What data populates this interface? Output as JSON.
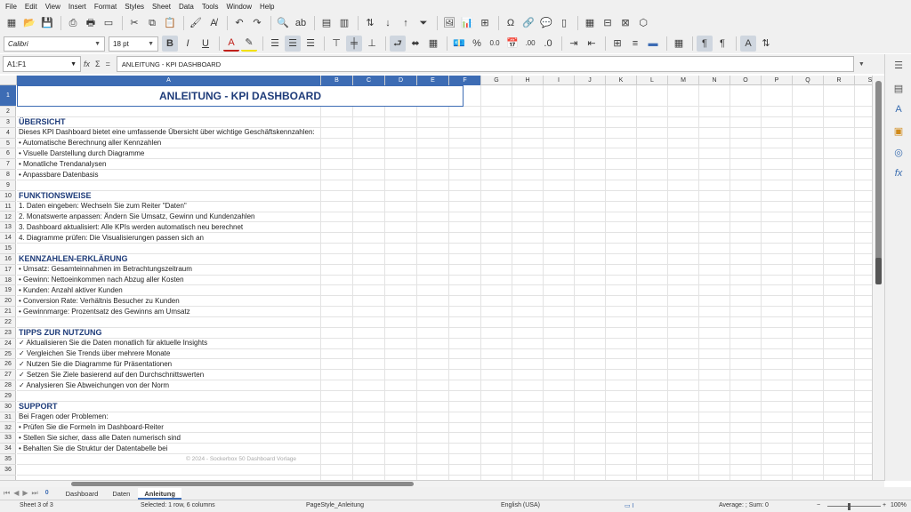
{
  "menu": [
    "File",
    "Edit",
    "View",
    "Insert",
    "Format",
    "Styles",
    "Sheet",
    "Data",
    "Tools",
    "Window",
    "Help"
  ],
  "toolbar": {
    "font_name": "Calibri",
    "font_size": "18 pt",
    "bold": "B",
    "italic": "I",
    "underline": "U",
    "percent": "%",
    "decimals": "0.0",
    "zero_decimal": ".00"
  },
  "formula_bar": {
    "name_box": "A1:F1",
    "fx": "fx",
    "sigma": "Σ",
    "equals": "=",
    "content": "ANLEITUNG - KPI DASHBOARD"
  },
  "grid": {
    "columns": [
      "A",
      "B",
      "C",
      "D",
      "E",
      "F",
      "G",
      "H",
      "I",
      "J",
      "K",
      "L",
      "M",
      "N",
      "O",
      "P",
      "Q",
      "R",
      "S"
    ],
    "rows": [
      "1",
      "2",
      "3",
      "4",
      "5",
      "6",
      "7",
      "8",
      "9",
      "10",
      "11",
      "12",
      "13",
      "14",
      "15",
      "16",
      "17",
      "18",
      "19",
      "20",
      "21",
      "22",
      "23",
      "24",
      "25",
      "26",
      "27",
      "28",
      "29",
      "30",
      "31",
      "32",
      "33",
      "34",
      "35",
      "36"
    ],
    "title": "ANLEITUNG - KPI DASHBOARD",
    "cells": {
      "r3": "ÜBERSICHT",
      "r4": "Dieses KPI Dashboard bietet eine umfassende Übersicht über wichtige Geschäftskennzahlen:",
      "r5": "• Automatische Berechnung aller Kennzahlen",
      "r6": "• Visuelle Darstellung durch Diagramme",
      "r7": "• Monatliche Trendanalysen",
      "r8": "• Anpassbare Datenbasis",
      "r10": "FUNKTIONSWEISE",
      "r11": "1. Daten eingeben: Wechseln Sie zum Reiter \"Daten\"",
      "r12": "2. Monatswerte anpassen: Ändern Sie Umsatz, Gewinn und Kundenzahlen",
      "r13": "3. Dashboard aktualisiert: Alle KPIs werden automatisch neu berechnet",
      "r14": "4. Diagramme prüfen: Die Visualisierungen passen sich an",
      "r16": "KENNZAHLEN-ERKLÄRUNG",
      "r17": "• Umsatz: Gesamteinnahmen im Betrachtungszeitraum",
      "r18": "• Gewinn: Nettoeinkommen nach Abzug aller Kosten",
      "r19": "• Kunden: Anzahl aktiver Kunden",
      "r20": "• Conversion Rate: Verhältnis Besucher zu Kunden",
      "r21": "• Gewinnmarge: Prozentsatz des Gewinns am Umsatz",
      "r23": "TIPPS ZUR NUTZUNG",
      "r24": "✓ Aktualisieren Sie die Daten monatlich für aktuelle Insights",
      "r25": "✓ Vergleichen Sie Trends über mehrere Monate",
      "r26": "✓ Nutzen Sie die Diagramme für Präsentationen",
      "r27": "✓ Setzen Sie Ziele basierend auf den Durchschnittswerten",
      "r28": "✓ Analysieren Sie Abweichungen von der Norm",
      "r30": "SUPPORT",
      "r31": "Bei Fragen oder Problemen:",
      "r32": "• Prüfen Sie die Formeln im Dashboard-Reiter",
      "r33": "• Stellen Sie sicher, dass alle Daten numerisch sind",
      "r34": "• Behalten Sie die Struktur der Datentabelle bei",
      "r35": "© 2024 - Sockerbox 50 Dashboard Vorlage"
    }
  },
  "tabs": {
    "add": "0",
    "items": [
      "Dashboard",
      "Daten",
      "Anleitung"
    ],
    "active": "Anleitung"
  },
  "status": {
    "sheet": "Sheet 3 of 3",
    "selection": "Selected: 1 row, 6 columns",
    "page_style": "PageStyle_Anleitung",
    "language": "English (USA)",
    "sum": "Average: ; Sum: 0",
    "zoom": "100%"
  },
  "colors": {
    "accent": "#3d6cb4",
    "heading": "#1f3c7a"
  }
}
